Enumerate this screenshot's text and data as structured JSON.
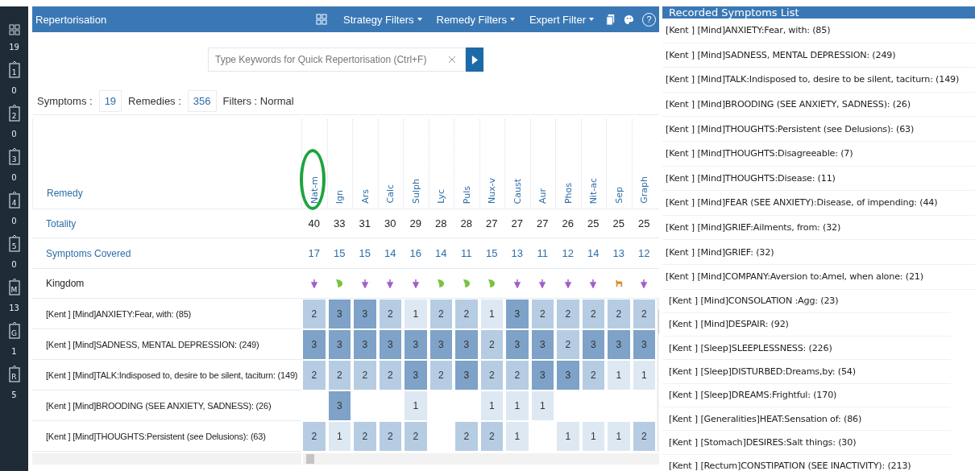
{
  "sidebar": {
    "top_count": "19",
    "tabs": [
      {
        "label": "1",
        "count": "0"
      },
      {
        "label": "2",
        "count": "0"
      },
      {
        "label": "3",
        "count": "0"
      },
      {
        "label": "4",
        "count": "0"
      },
      {
        "label": "5",
        "count": "0"
      },
      {
        "label": "M",
        "count": "13"
      },
      {
        "label": "G",
        "count": "1"
      },
      {
        "label": "R",
        "count": "5"
      }
    ]
  },
  "window": {
    "title": "Repertorisation",
    "menus": [
      "Strategy Filters",
      "Remedy Filters",
      "Expert Filter"
    ],
    "help": "?"
  },
  "search": {
    "placeholder": "Type Keywords for Quick Repertorisation (Ctrl+F)"
  },
  "stats": {
    "symptoms_label": "Symptoms :",
    "symptoms": "19",
    "remedies_label": "Remedies :",
    "remedies": "356",
    "filters": "Filters : Normal"
  },
  "table": {
    "header_label": "Remedy",
    "totality_label": "Totality",
    "covered_label": "Symptoms Covered",
    "kingdom_label": "Kingdom",
    "remedies": [
      {
        "name": "Nat-m",
        "highlighted": true,
        "totality": "40",
        "covered": "17",
        "kind": "mineral"
      },
      {
        "name": "Ign",
        "highlighted": false,
        "totality": "33",
        "covered": "15",
        "kind": "plant"
      },
      {
        "name": "Ars",
        "highlighted": false,
        "totality": "31",
        "covered": "15",
        "kind": "mineral"
      },
      {
        "name": "Calc",
        "highlighted": false,
        "totality": "30",
        "covered": "14",
        "kind": "mineral"
      },
      {
        "name": "Sulph",
        "highlighted": false,
        "totality": "29",
        "covered": "16",
        "kind": "mineral"
      },
      {
        "name": "Lyc",
        "highlighted": false,
        "totality": "28",
        "covered": "14",
        "kind": "plant"
      },
      {
        "name": "Puls",
        "highlighted": false,
        "totality": "28",
        "covered": "11",
        "kind": "plant"
      },
      {
        "name": "Nux-v",
        "highlighted": false,
        "totality": "27",
        "covered": "15",
        "kind": "plant"
      },
      {
        "name": "Caust",
        "highlighted": false,
        "totality": "27",
        "covered": "13",
        "kind": "mineral"
      },
      {
        "name": "Aur",
        "highlighted": false,
        "totality": "27",
        "covered": "11",
        "kind": "mineral"
      },
      {
        "name": "Phos",
        "highlighted": false,
        "totality": "26",
        "covered": "12",
        "kind": "mineral"
      },
      {
        "name": "Nit-ac",
        "highlighted": false,
        "totality": "25",
        "covered": "14",
        "kind": "mineral"
      },
      {
        "name": "Sep",
        "highlighted": false,
        "totality": "25",
        "covered": "13",
        "kind": "animal"
      },
      {
        "name": "Graph",
        "highlighted": false,
        "totality": "25",
        "covered": "12",
        "kind": "mineral"
      }
    ],
    "rows": [
      {
        "symptom": "[Kent ] [Mind]ANXIETY:Fear, with: (85)",
        "cells": [
          {
            "kind": "grade",
            "value": "2"
          },
          {
            "kind": "grade",
            "value": "3"
          },
          {
            "kind": "grade",
            "value": "3"
          },
          {
            "kind": "grade",
            "value": "2"
          },
          {
            "kind": "grade",
            "value": "1"
          },
          {
            "kind": "grade",
            "value": "2"
          },
          {
            "kind": "grade",
            "value": "2"
          },
          {
            "kind": "grade",
            "value": "1"
          },
          {
            "kind": "grade",
            "value": "3"
          },
          {
            "kind": "grade",
            "value": "2"
          },
          {
            "kind": "grade",
            "value": "2"
          },
          {
            "kind": "grade",
            "value": "2"
          },
          {
            "kind": "grade",
            "value": "2"
          },
          {
            "kind": "grade",
            "value": "2"
          }
        ]
      },
      {
        "symptom": "[Kent ] [Mind]SADNESS, MENTAL DEPRESSION: (249)",
        "cells": [
          {
            "kind": "grade",
            "value": "3"
          },
          {
            "kind": "grade",
            "value": "3"
          },
          {
            "kind": "grade",
            "value": "3"
          },
          {
            "kind": "grade",
            "value": "3"
          },
          {
            "kind": "grade",
            "value": "3"
          },
          {
            "kind": "grade",
            "value": "3"
          },
          {
            "kind": "grade",
            "value": "3"
          },
          {
            "kind": "grade",
            "value": "2"
          },
          {
            "kind": "grade",
            "value": "3"
          },
          {
            "kind": "grade",
            "value": "3"
          },
          {
            "kind": "grade",
            "value": "2"
          },
          {
            "kind": "grade",
            "value": "3"
          },
          {
            "kind": "grade",
            "value": "3"
          },
          {
            "kind": "grade",
            "value": "3"
          }
        ]
      },
      {
        "symptom": "[Kent ] [Mind]TALK:Indisposed to, desire to be silent, taciturn: (149)",
        "cells": [
          {
            "kind": "grade",
            "value": "2"
          },
          {
            "kind": "grade",
            "value": "2"
          },
          {
            "kind": "grade",
            "value": "2"
          },
          {
            "kind": "grade",
            "value": "2"
          },
          {
            "kind": "grade",
            "value": "3"
          },
          {
            "kind": "grade",
            "value": "2"
          },
          {
            "kind": "grade",
            "value": "3"
          },
          {
            "kind": "grade",
            "value": "2"
          },
          {
            "kind": "grade",
            "value": "2"
          },
          {
            "kind": "grade",
            "value": "3"
          },
          {
            "kind": "grade",
            "value": "3"
          },
          {
            "kind": "grade",
            "value": "2"
          },
          {
            "kind": "grade",
            "value": "1"
          },
          {
            "kind": "grade",
            "value": "1"
          }
        ]
      },
      {
        "symptom": "[Kent ] [Mind]BROODING (SEE ANXIETY, SADNESS): (26)",
        "cells": [
          {
            "kind": "blank"
          },
          {
            "kind": "grade",
            "value": "3"
          },
          {
            "kind": "blank"
          },
          {
            "kind": "blank"
          },
          {
            "kind": "grade",
            "value": "1"
          },
          {
            "kind": "blank"
          },
          {
            "kind": "blank"
          },
          {
            "kind": "grade",
            "value": "1"
          },
          {
            "kind": "grade",
            "value": "1"
          },
          {
            "kind": "grade",
            "value": "1"
          },
          {
            "kind": "blank"
          },
          {
            "kind": "blank"
          },
          {
            "kind": "blank"
          },
          {
            "kind": "blank"
          }
        ]
      },
      {
        "symptom": "[Kent ] [Mind]THOUGHTS:Persistent (see Delusions): (63)",
        "cells": [
          {
            "kind": "grade",
            "value": "2"
          },
          {
            "kind": "grade",
            "value": "1"
          },
          {
            "kind": "grade",
            "value": "2"
          },
          {
            "kind": "grade",
            "value": "2"
          },
          {
            "kind": "grade",
            "value": "2"
          },
          {
            "kind": "blank"
          },
          {
            "kind": "grade",
            "value": "2"
          },
          {
            "kind": "grade",
            "value": "2"
          },
          {
            "kind": "grade",
            "value": "1"
          },
          {
            "kind": "blank"
          },
          {
            "kind": "grade",
            "value": "1"
          },
          {
            "kind": "grade",
            "value": "1"
          },
          {
            "kind": "grade",
            "value": "1"
          },
          {
            "kind": "grade",
            "value": "2"
          }
        ]
      }
    ]
  },
  "symptoms_list": {
    "title": "Recorded Symptoms List",
    "items": [
      "[Kent ] [Mind]ANXIETY:Fear, with: (85)",
      "[Kent ] [Mind]SADNESS, MENTAL DEPRESSION: (249)",
      "[Kent ] [Mind]TALK:Indisposed to, desire to be silent, taciturn: (149)",
      "[Kent ] [Mind]BROODING (SEE ANXIETY, SADNESS): (26)",
      "[Kent ] [Mind]THOUGHTS:Persistent (see Delusions): (63)",
      "[Kent ] [Mind]THOUGHTS:Disagreeable: (7)",
      "[Kent ] [Mind]THOUGHTS:Disease: (11)",
      "[Kent ] [Mind]FEAR (SEE ANXIETY):Disease, of impending: (44)",
      "[Kent ] [Mind]GRIEF:Ailments, from: (32)",
      "[Kent ] [Mind]GRIEF: (32)",
      "[Kent ] [Mind]COMPANY:Aversion to:Amel, when alone: (21)",
      "[Kent ] [Mind]CONSOLATION :Agg: (23)",
      "[Kent ] [Mind]DESPAIR: (92)",
      "[Kent ] [Sleep]SLEEPLESSNESS: (226)",
      "[Kent ] [Sleep]DISTURBED:Dreams,by: (54)",
      "[Kent ] [Sleep]DREAMS:Frightful: (170)",
      "[Kent ] [Generalities]HEAT:Sensation of: (86)",
      "[Kent ] [Stomach]DESIRES:Salt things: (30)",
      "[Kent ] [Rectum]CONSTIPATION (SEE INACTIVITY): (213)"
    ]
  }
}
